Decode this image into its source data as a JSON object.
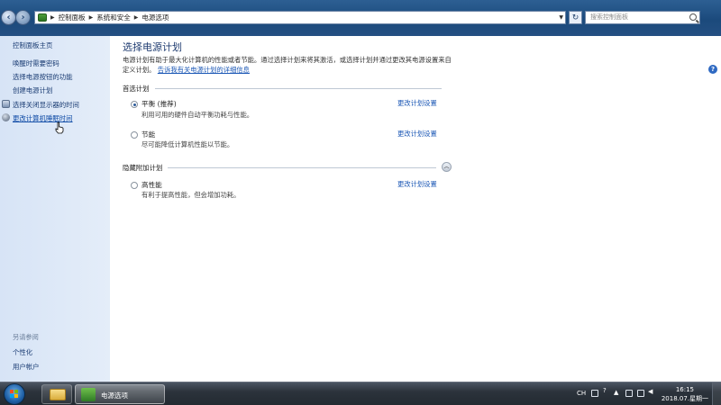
{
  "address": {
    "crumbs": [
      "控制面板",
      "系统和安全",
      "电源选项"
    ],
    "search_placeholder": "搜索控制面板"
  },
  "sidebar": {
    "home": "控制面板主页",
    "items": [
      {
        "label": "唤醒时需要密码"
      },
      {
        "label": "选择电源按钮的功能"
      },
      {
        "label": "创建电源计划"
      },
      {
        "label": "选择关闭显示器的时间"
      },
      {
        "label": "更改计算机睡眠时间"
      }
    ],
    "see_also_heading": "另请参阅",
    "see_also": [
      {
        "label": "个性化"
      },
      {
        "label": "用户帐户"
      }
    ]
  },
  "main": {
    "title": "选择电源计划",
    "description": "电源计划有助于最大化计算机的性能或者节能。通过选择计划来将其激活，或选择计划并通过更改其电源设置来自定义计划。",
    "description_link": "告诉我有关电源计划的详细信息",
    "preferred_heading": "首选计划",
    "hidden_heading": "隐藏附加计划",
    "plans": [
      {
        "name": "平衡 (推荐)",
        "desc": "利用可用的硬件自动平衡功耗与性能。",
        "link": "更改计划设置",
        "selected": true
      },
      {
        "name": "节能",
        "desc": "尽可能降低计算机性能以节能。",
        "link": "更改计划设置",
        "selected": false
      },
      {
        "name": "高性能",
        "desc": "有利于提高性能，但会增加功耗。",
        "link": "更改计划设置",
        "selected": false
      }
    ]
  },
  "taskbar": {
    "active_window": "电源选项",
    "input_indicator": "CH",
    "time": "16:15",
    "date": "2018.07.星期一"
  },
  "colors": {
    "link": "#1b57b5",
    "title": "#1e3b70",
    "sidebar_bg": "#dfe9f7"
  }
}
